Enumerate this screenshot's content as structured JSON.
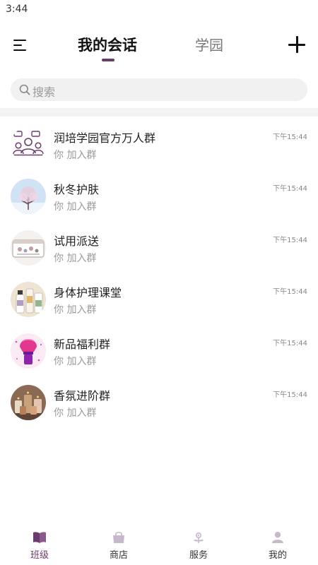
{
  "status_bar": {
    "time": "3:44"
  },
  "header": {
    "tabs": [
      {
        "label": "我的会话",
        "active": true
      },
      {
        "label": "学园",
        "active": false
      }
    ],
    "accent_color": "#6b3b6e"
  },
  "search": {
    "placeholder": "搜索"
  },
  "conversations": [
    {
      "name": "润培学园官方万人群",
      "preview": "你 加入群",
      "time": "下午15:44",
      "avatar": "group-people-icon"
    },
    {
      "name": "秋冬护肤",
      "preview": "你 加入群",
      "time": "下午15:44",
      "avatar": "winter-tree-photo"
    },
    {
      "name": "试用派送",
      "preview": "你 加入群",
      "time": "下午15:44",
      "avatar": "gift-box-photo"
    },
    {
      "name": "身体护理课堂",
      "preview": "你 加入群",
      "time": "下午15:44",
      "avatar": "body-care-bottles-photo"
    },
    {
      "name": "新品福利群",
      "preview": "你 加入群",
      "time": "下午15:44",
      "avatar": "makeup-brush-photo"
    },
    {
      "name": "香氛进阶群",
      "preview": "你 加入群",
      "time": "下午15:44",
      "avatar": "candles-photo"
    }
  ],
  "bottom_nav": [
    {
      "label": "班级",
      "icon": "book-icon",
      "active": true
    },
    {
      "label": "商店",
      "icon": "shopping-bag-icon",
      "active": false
    },
    {
      "label": "服务",
      "icon": "service-flower-icon",
      "active": false
    },
    {
      "label": "我的",
      "icon": "person-icon",
      "active": false
    }
  ]
}
